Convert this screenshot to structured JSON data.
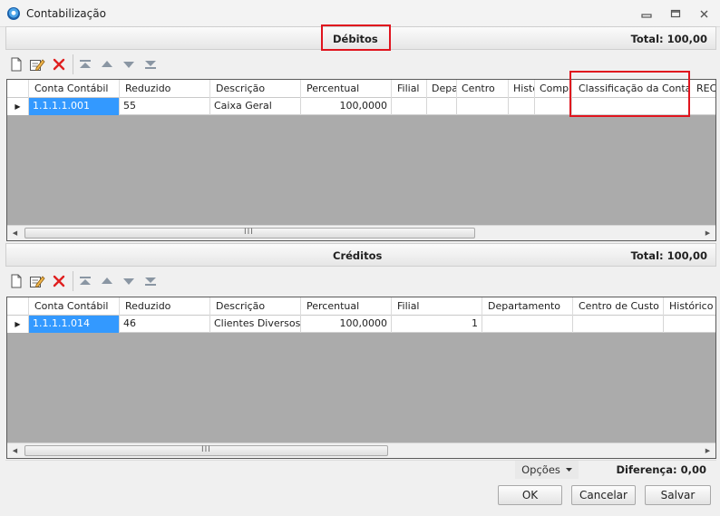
{
  "window": {
    "title": "Contabilização"
  },
  "debitos": {
    "title": "Débitos",
    "total": "Total: 100,00",
    "columns": [
      "Conta Contábil",
      "Reduzido",
      "Descrição",
      "Percentual",
      "Filial",
      "Depa",
      "Centro",
      "Histo",
      "Comple",
      "Classificação da Conta",
      "REC"
    ],
    "row": {
      "conta": "1.1.1.1.001",
      "reduzido": "55",
      "descricao": "Caixa Geral",
      "percentual": "100,0000"
    },
    "scroll_grip": "III"
  },
  "creditos": {
    "title": "Créditos",
    "total": "Total: 100,00",
    "columns": [
      "Conta Contábil",
      "Reduzido",
      "Descrição",
      "Percentual",
      "Filial",
      "Departamento",
      "Centro de Custo",
      "Histórico P"
    ],
    "row": {
      "conta": "1.1.1.1.014",
      "reduzido": "46",
      "descricao": "Clientes Diversos",
      "percentual": "100,0000",
      "filial": "1"
    },
    "scroll_grip": "III"
  },
  "footer": {
    "options_label": "Opções",
    "diferenca": "Diferença: 0,00",
    "ok_label": "OK",
    "cancel_label": "Cancelar",
    "save_label": "Salvar"
  },
  "colors": {
    "selection": "#3399ff",
    "highlight": "#e0141e",
    "grid_background": "#ababab"
  }
}
